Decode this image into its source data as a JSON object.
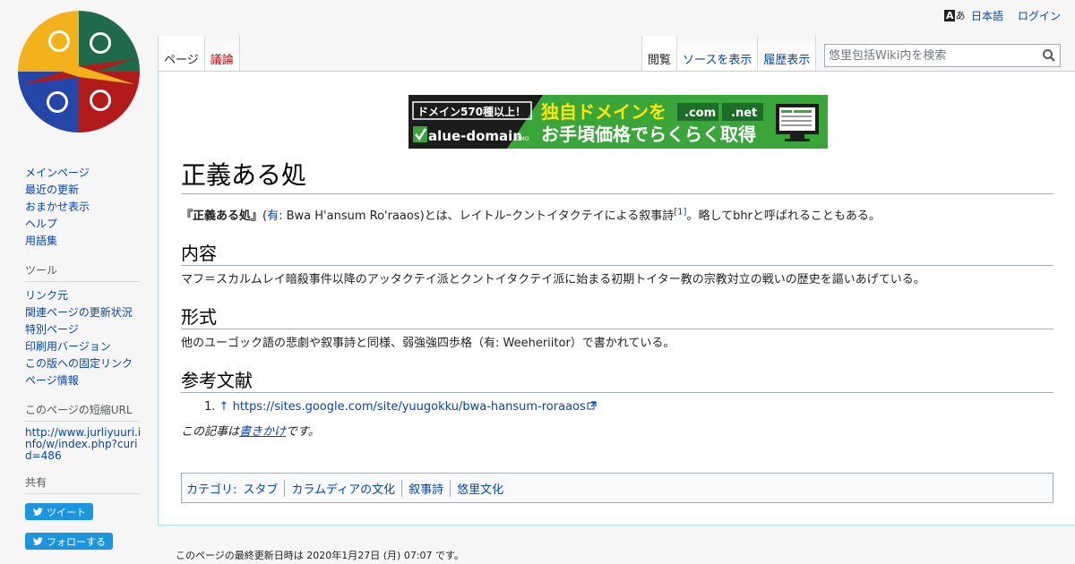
{
  "personal": {
    "lang_icon_a": "A",
    "lang_icon_b": "あ",
    "language": "日本語",
    "login": "ログイン"
  },
  "tabs": {
    "page": "ページ",
    "talk": "議論",
    "read": "閲覧",
    "view_source": "ソースを表示",
    "history": "履歴表示"
  },
  "search": {
    "placeholder": "悠里包括Wiki内を検索"
  },
  "banner": {
    "badge": "ドメイン570種以上！",
    "headline": "独自ドメインを",
    "tld1": ".com",
    "tld2": ".net",
    "brand": "alue-domain",
    "brand_suffix": ".GMO",
    "tagline": "お手頃価格でらくらく取得"
  },
  "article": {
    "title": "正義ある処",
    "lead_bold": "『正義ある処』",
    "lead_paren_open": "(",
    "lead_lang": "有",
    "lead_after_lang": ": Bwa H'ansum Ro'raaos)とは、レイトルｰクントイタクテイによる叙事詩",
    "lead_ref": "[1]",
    "lead_end": "。略してbhrと呼ばれることもある。",
    "sections": [
      {
        "heading": "内容",
        "text": "マフ＝スカルムレイ暗殺事件以降のアッタクテイ派とクントイタクテイ派に始まる初期トイター教の宗教対立の戦いの歴史を謳いあげている。"
      },
      {
        "heading": "形式",
        "text": "他のユーゴック語の悲劇や叙事詩と同様、弱強強四歩格（有: Weeheriitor）で書かれている。"
      },
      {
        "heading": "参考文献"
      }
    ],
    "ref_number": "1.",
    "ref_arrow": "↑",
    "ref_url": "https://sites.google.com/site/yuugokku/bwa-hansum-roraaos",
    "stub_prefix": "この記事は",
    "stub_link": "書きかけ",
    "stub_suffix": "です。"
  },
  "categories": {
    "label": "カテゴリ:",
    "items": [
      "スタブ",
      "カラムディアの文化",
      "叙事詩",
      "悠里文化"
    ]
  },
  "sidebar": {
    "navigation": [
      "メインページ",
      "最近の更新",
      "おまかせ表示",
      "ヘルプ",
      "用語集"
    ],
    "tools_heading": "ツール",
    "tools": [
      "リンク元",
      "関連ページの更新状況",
      "特別ページ",
      "印刷用バージョン",
      "この版への固定リンク",
      "ページ情報"
    ],
    "short_url_heading": "このページの短縮URL",
    "short_url": "http://www.jurliyuuri.info/w/index.php?curid=486",
    "share_heading": "共有",
    "tweet": "ツイート",
    "follow": "フォローする"
  },
  "footer": {
    "last_modified": "このページの最終更新日時は 2020年1月27日 (月) 07:07 です。"
  },
  "colors": {
    "link": "#0645ad",
    "new_link": "#ba0000",
    "twitter": "#1b95e0",
    "banner_green": "#3aa63a",
    "banner_yellow": "#ffe600"
  }
}
